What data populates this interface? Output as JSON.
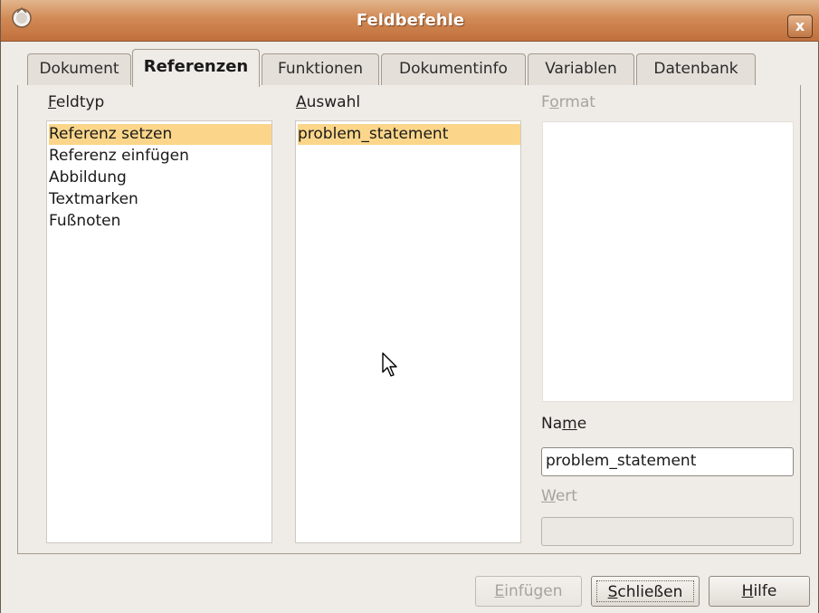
{
  "window": {
    "title": "Feldbefehle",
    "close_label": "x"
  },
  "tabs": [
    {
      "label": "Dokument",
      "active": false
    },
    {
      "label": "Referenzen",
      "active": true
    },
    {
      "label": "Funktionen",
      "active": false
    },
    {
      "label": "Dokumentinfo",
      "active": false
    },
    {
      "label": "Variablen",
      "active": false
    },
    {
      "label": "Datenbank",
      "active": false
    }
  ],
  "feldtyp": {
    "label_mnemonic": "F",
    "label_rest": "eldtyp",
    "items": [
      {
        "label": "Referenz setzen",
        "selected": true
      },
      {
        "label": "Referenz einfügen",
        "selected": false
      },
      {
        "label": "Abbildung",
        "selected": false
      },
      {
        "label": "Textmarken",
        "selected": false
      },
      {
        "label": "Fußnoten",
        "selected": false
      }
    ]
  },
  "auswahl": {
    "label_mnemonic": "A",
    "label_rest": "uswahl",
    "items": [
      {
        "label": "problem_statement",
        "selected": true
      }
    ]
  },
  "format": {
    "label_pre": "F",
    "label_mnemonic": "o",
    "label_rest": "rmat",
    "enabled": false
  },
  "name": {
    "label_pre": "Na",
    "label_mnemonic": "m",
    "label_rest": "e",
    "value": "problem_statement"
  },
  "wert": {
    "label_mnemonic": "W",
    "label_rest": "ert",
    "value": "",
    "enabled": false
  },
  "buttons": {
    "insert": {
      "mnemonic": "E",
      "rest": "infügen",
      "enabled": false
    },
    "close": {
      "mnemonic": "S",
      "rest": "chließen",
      "enabled": true
    },
    "help": {
      "mnemonic": "H",
      "rest": "ilfe",
      "enabled": true
    }
  },
  "colors": {
    "titlebar": "#d28a55",
    "selection": "#fbd68a",
    "window_bg": "#efebe7"
  }
}
